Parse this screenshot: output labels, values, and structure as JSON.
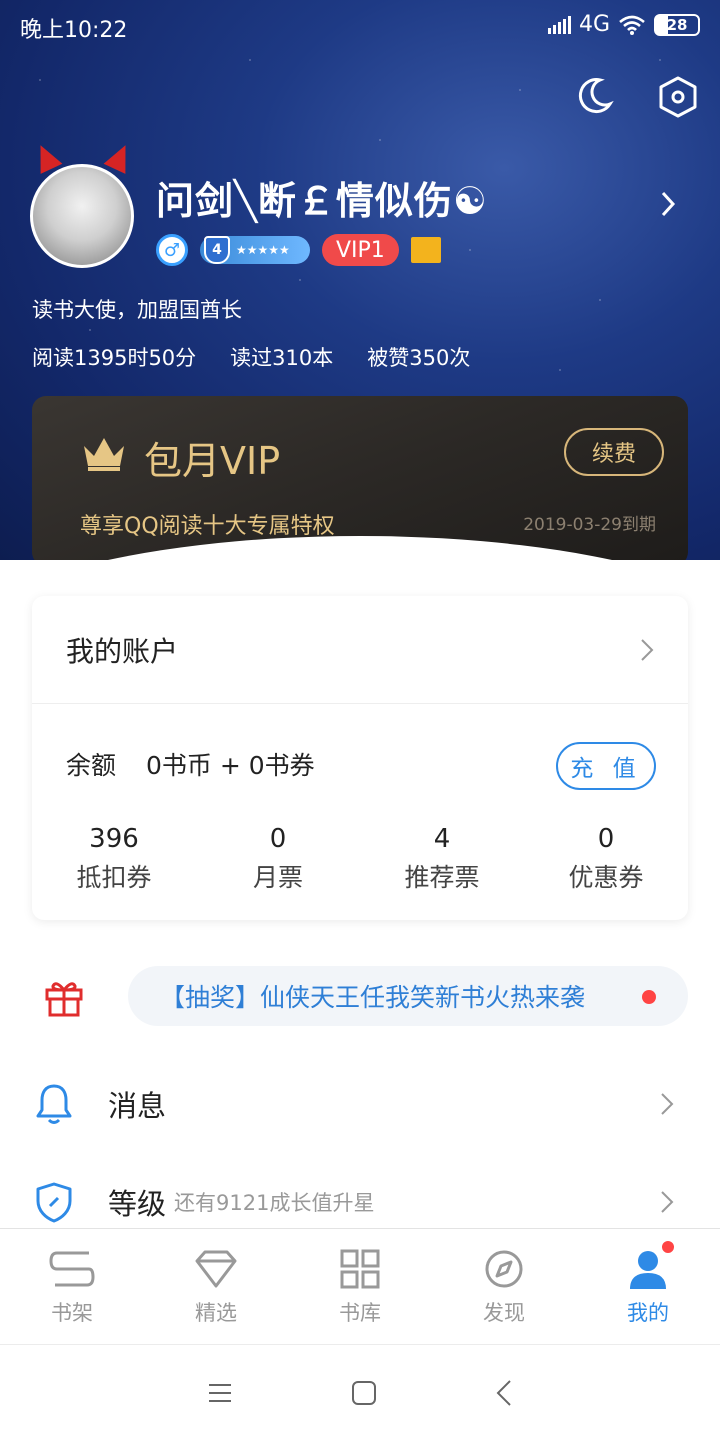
{
  "status_bar": {
    "time": "晚上10:22",
    "network": "4G",
    "battery": "28"
  },
  "profile": {
    "name": "问剑╲断￡情似伤☯",
    "level_number": "4",
    "vip_badge": "VIP1",
    "title": "读书大使，加盟国酋长",
    "stats": [
      "阅读1395时50分",
      "读过310本",
      "被赞350次"
    ]
  },
  "vip_card": {
    "title": "包月VIP",
    "renew_label": "续费",
    "subtitle": "尊享QQ阅读十大专属特权",
    "expiry": "2019-03-29到期"
  },
  "account": {
    "title": "我的账户",
    "balance_label": "余额",
    "balance_value": "0书币 + 0书券",
    "topup_label": "充 值",
    "tickets": [
      {
        "value": "396",
        "label": "抵扣券"
      },
      {
        "value": "0",
        "label": "月票"
      },
      {
        "value": "4",
        "label": "推荐票"
      },
      {
        "value": "0",
        "label": "优惠券"
      }
    ]
  },
  "lottery": {
    "text": "【抽奖】仙侠天王任我笑新书火热来袭"
  },
  "menu": {
    "messages": "消息",
    "level": "等级",
    "level_hint": "还有9121成长值升星"
  },
  "tabs": [
    "书架",
    "精选",
    "书库",
    "发现",
    "我的"
  ],
  "colors": {
    "accent": "#2e8ae6",
    "vip_gold": "#e6c685",
    "alert": "#f44444",
    "hero_bg": "#13286a"
  }
}
